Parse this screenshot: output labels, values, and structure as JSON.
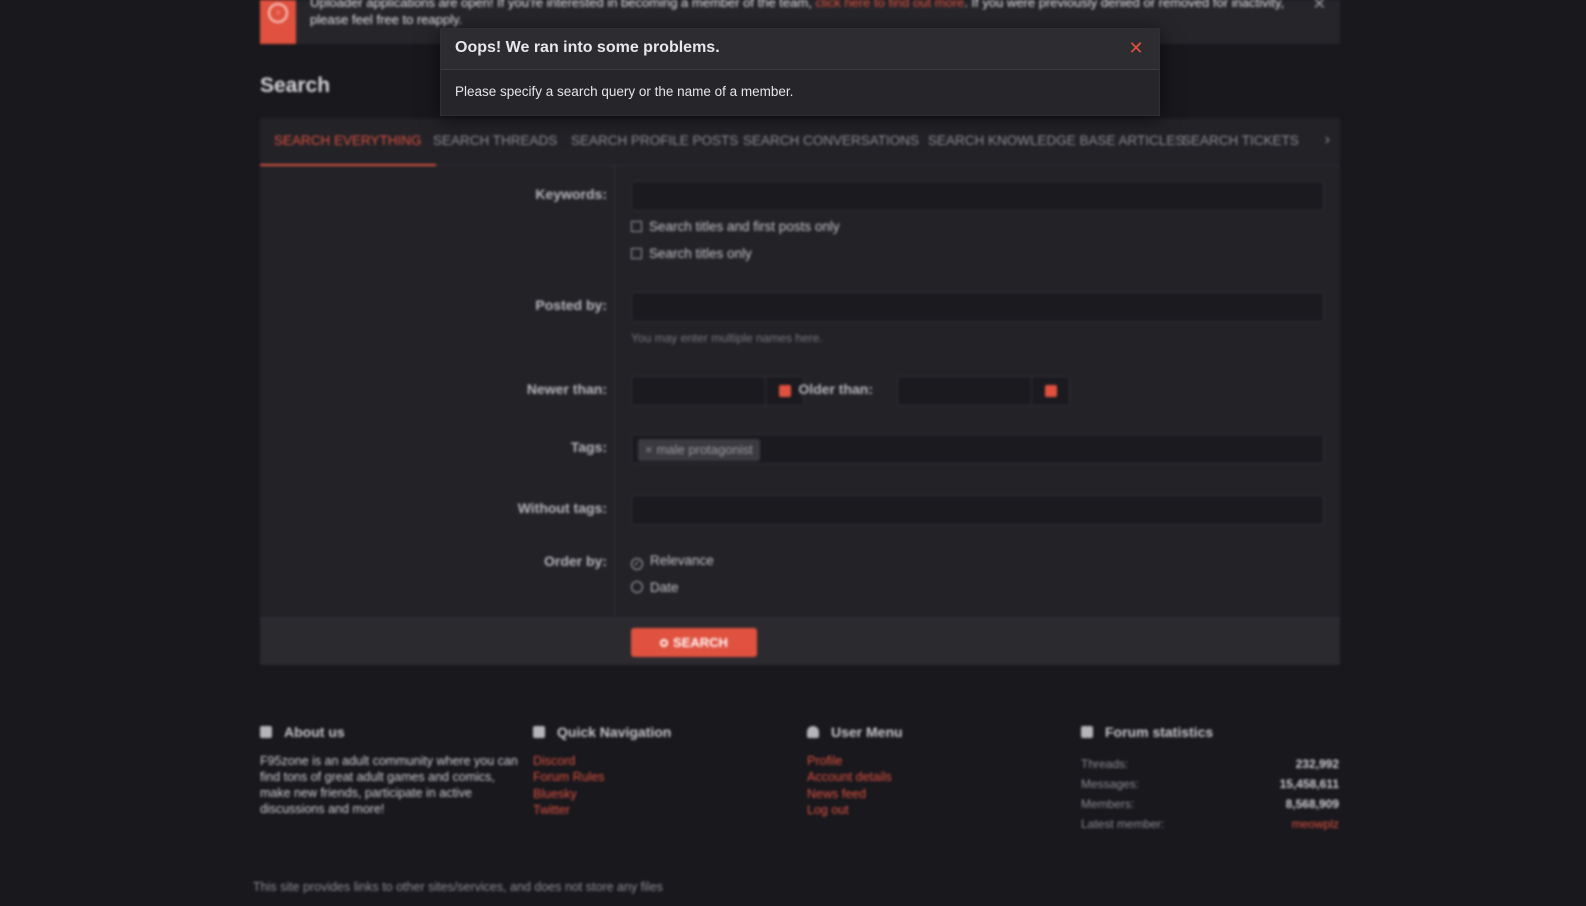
{
  "notice": {
    "text_before": "Uploader applications are open! If you're interested in becoming a member of the team, ",
    "link_text": "click here to find out more",
    "text_after": ". If you were previously denied or removed for inactivity, please feel free to reapply.",
    "close": "✕"
  },
  "page": {
    "title": "Search"
  },
  "tabs": [
    "SEARCH EVERYTHING",
    "SEARCH THREADS",
    "SEARCH PROFILE POSTS",
    "SEARCH CONVERSATIONS",
    "SEARCH KNOWLEDGE BASE ARTICLES",
    "SEARCH TICKETS"
  ],
  "tabs_more": "›",
  "form": {
    "keywords_label": "Keywords:",
    "keywords_value": "",
    "check_titles_first": "Search titles and first posts only",
    "check_titles_only": "Search titles only",
    "posted_by_label": "Posted by:",
    "posted_by_value": "",
    "posted_by_hint": "You may enter multiple names here.",
    "newer_than_label": "Newer than:",
    "older_than_label": "Older than:",
    "tags_label": "Tags:",
    "tag_chip_remove": "×",
    "tag_chip": "male protagonist",
    "without_tags_label": "Without tags:",
    "order_by_label": "Order by:",
    "order_options": [
      "Relevance",
      "Date"
    ],
    "order_selected": "Relevance",
    "search_button": "SEARCH"
  },
  "footer": {
    "about": {
      "title": "About us",
      "text": "F95zone is an adult community where you can find tons of great adult games and comics, make new friends, participate in active discussions and more!"
    },
    "quick_nav": {
      "title": "Quick Navigation",
      "links": [
        "Discord",
        "Forum Rules",
        "Bluesky",
        "Twitter"
      ]
    },
    "user_menu": {
      "title": "User Menu",
      "links": [
        "Profile",
        "Account details",
        "News feed",
        "Log out"
      ]
    },
    "stats": {
      "title": "Forum statistics",
      "rows": [
        {
          "label": "Threads:",
          "value": "232,992"
        },
        {
          "label": "Messages:",
          "value": "15,458,611"
        },
        {
          "label": "Members:",
          "value": "8,568,909"
        },
        {
          "label": "Latest member:",
          "value": "meowplz"
        }
      ]
    },
    "disclaimer": "This site provides links to other sites/services, and does not store any files"
  },
  "modal": {
    "title": "Oops! We ran into some problems.",
    "message": "Please specify a search query or the name of a member.",
    "close": "✕"
  },
  "colors": {
    "accent": "#e0513f",
    "background": "#18181d",
    "panel": "#222227"
  }
}
